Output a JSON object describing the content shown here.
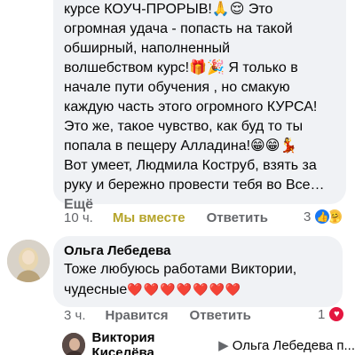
{
  "comment1": {
    "lines": [
      "курсе  КОУЧ-ПРОРЫВ!🙏😌 Это",
      "огромная удача -  попасть на такой",
      "обширный,  наполненный",
      "волшебством курс!🎁🎉 Я только в",
      "начале пути обучения , но смакую",
      "каждую часть этого огромного КУРСА!",
      "Это же,  такое чувство, как буд то ты",
      "попала в пещеру Алладина!😁😁💃",
      "Вот умеет, Людмила Коструб, взять за",
      "руку и бережно провести тебя  во Все…"
    ],
    "more_label": "Ещё",
    "time": "10 ч.",
    "like_label": "Мы вместе",
    "reply_label": "Ответить",
    "reaction_count": "3"
  },
  "comment2": {
    "author": "Ольга Лебедева",
    "text_line1": "Тоже любуюсь работами Виктории,",
    "text_line2": "чудесные",
    "hearts": "❤️❤️❤️❤️❤️❤️❤️",
    "time": "3 ч.",
    "like_label": "Нравится",
    "reply_label": "Ответить",
    "reaction_count": "1"
  },
  "reply": {
    "author": "Виктория Киселёва",
    "reply_to": "Ольга Лебедева п..."
  },
  "colors": {
    "bubble_bg": "#f0f2f5",
    "muted_text": "#65676b",
    "active_like": "#b5a42a",
    "heart": "#e4163f",
    "like_blue": "#1877f2"
  }
}
